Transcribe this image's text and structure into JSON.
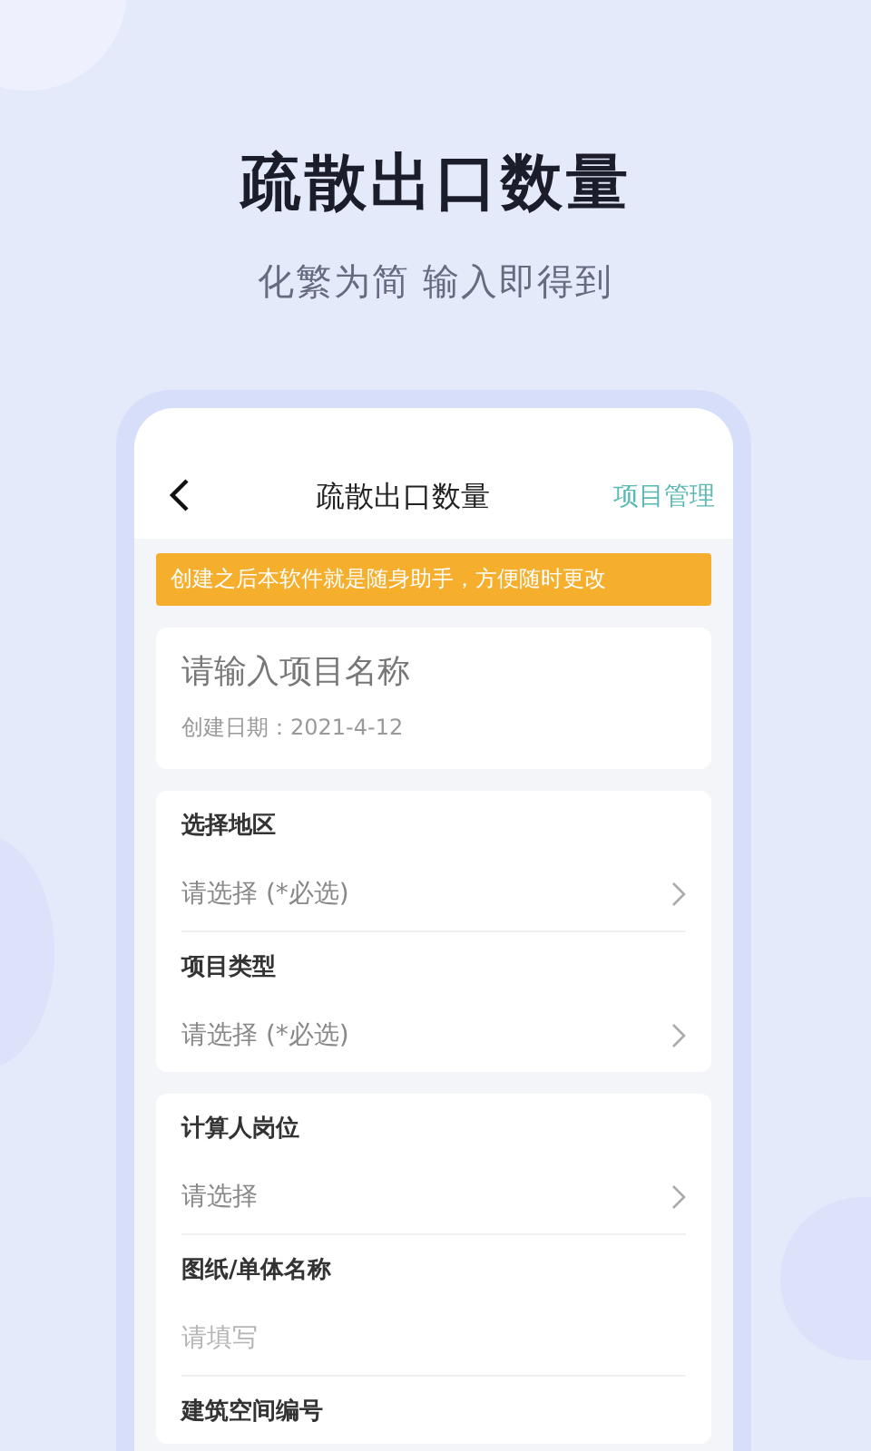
{
  "header": {
    "title": "疏散出口数量",
    "subtitle": "化繁为简 输入即得到"
  },
  "phone": {
    "nav": {
      "title": "疏散出口数量",
      "action": "项目管理"
    },
    "notice": "创建之后本软件就是随身助手，方便随时更改",
    "project": {
      "placeholder": "请输入项目名称",
      "created": "创建日期：2021-4-12"
    },
    "sections": [
      {
        "fields": [
          {
            "label": "选择地区",
            "kind": "select",
            "placeholder": "请选择 (*必选)"
          },
          {
            "label": "项目类型",
            "kind": "select",
            "placeholder": "请选择 (*必选)"
          }
        ]
      },
      {
        "fields": [
          {
            "label": "计算人岗位",
            "kind": "select",
            "placeholder": "请选择"
          },
          {
            "label": "图纸/单体名称",
            "kind": "input",
            "placeholder": "请填写"
          },
          {
            "label": "建筑空间编号"
          }
        ]
      }
    ]
  }
}
